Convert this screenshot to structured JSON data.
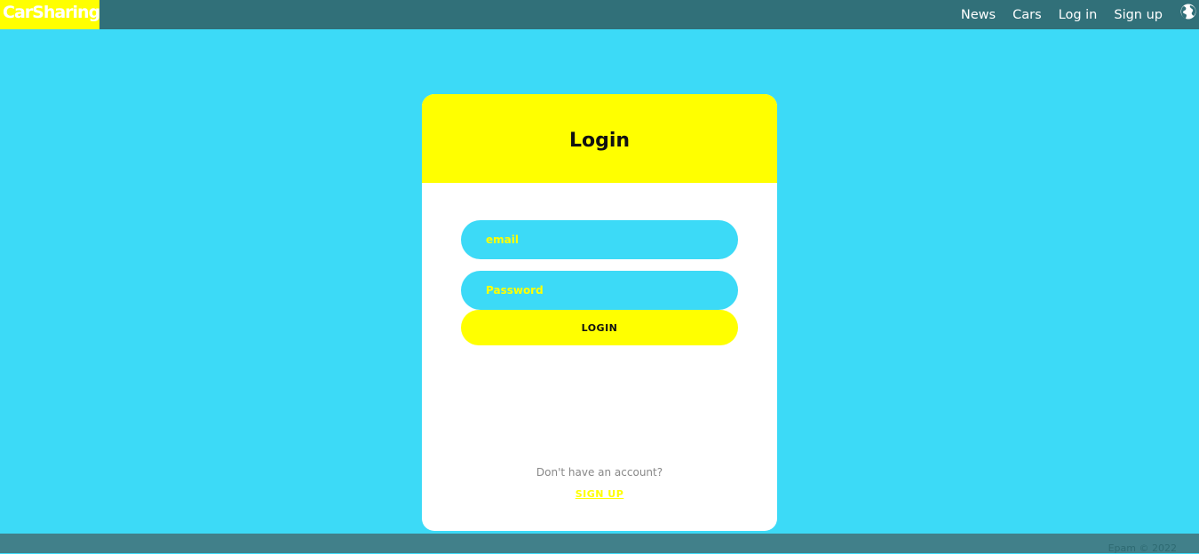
{
  "header": {
    "brand": "CarSharing",
    "nav": [
      "News",
      "Cars",
      "Log in",
      "Sign up"
    ],
    "language_icon": "globe-icon"
  },
  "login": {
    "title": "Login",
    "email_placeholder": "email",
    "password_placeholder": "Password",
    "submit_label": "LOGIN",
    "no_account_text": "Don't have an account?",
    "signup_label": "SIGN UP"
  },
  "footer": {
    "text": "Epam © 2022"
  },
  "colors": {
    "background": "#3cdaf7",
    "header": "#317079",
    "accent": "#ffff00",
    "footer": "#41808a"
  }
}
